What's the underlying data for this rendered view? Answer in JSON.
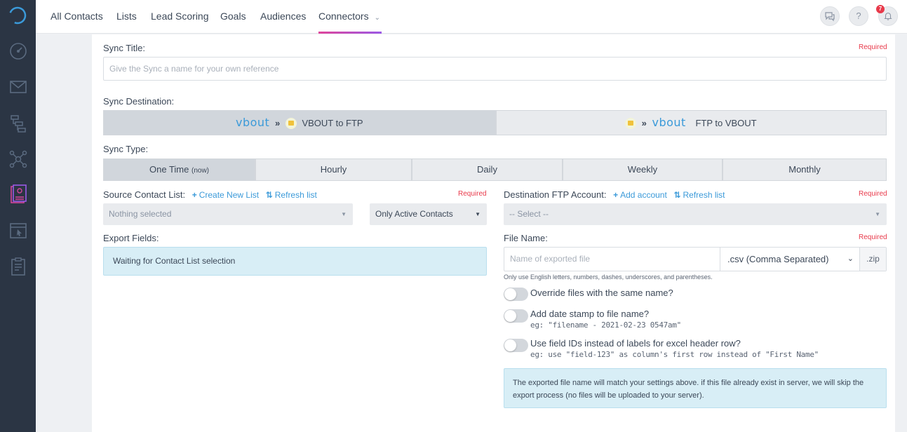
{
  "nav": {
    "items": [
      "All Contacts",
      "Lists",
      "Lead Scoring",
      "Goals",
      "Audiences",
      "Connectors"
    ],
    "notification_count": "7",
    "help_label": "?"
  },
  "form": {
    "sync_title": {
      "label": "Sync Title:",
      "required": "Required",
      "placeholder": "Give the Sync a name for your own reference"
    },
    "destination": {
      "label": "Sync Destination:",
      "vbout_to_ftp": {
        "brand": "vbout",
        "arrows": "»",
        "label": "VBOUT to FTP"
      },
      "ftp_to_vbout": {
        "brand": "vbout",
        "arrows": "»",
        "label": "FTP to VBOUT"
      }
    },
    "sync_type": {
      "label": "Sync Type:",
      "options": [
        {
          "label": "One Time",
          "suffix": "(now)"
        },
        {
          "label": "Hourly",
          "suffix": ""
        },
        {
          "label": "Daily",
          "suffix": ""
        },
        {
          "label": "Weekly",
          "suffix": ""
        },
        {
          "label": "Monthly",
          "suffix": ""
        }
      ]
    },
    "source": {
      "label": "Source Contact List:",
      "create_link": "Create New List",
      "refresh_link": "Refresh list",
      "required": "Required",
      "list_select": "Nothing selected",
      "status_select": "Only Active Contacts"
    },
    "destination_ftp": {
      "label": "Destination FTP Account:",
      "add_link": "Add account",
      "refresh_link": "Refresh list",
      "required": "Required",
      "select": "-- Select --"
    },
    "export_fields": {
      "label": "Export Fields:",
      "waiting": "Waiting for Contact List selection"
    },
    "file_name": {
      "label": "File Name:",
      "required": "Required",
      "placeholder": "Name of exported file",
      "format": ".csv (Comma Separated)",
      "ext": ".zip",
      "hint": "Only use English letters, numbers, dashes, underscores, and parentheses."
    },
    "toggles": [
      {
        "label": "Override files with the same name?",
        "sub": "",
        "on": false
      },
      {
        "label": "Add date stamp to file name?",
        "sub": "eg: \"filename - 2021-02-23 0547am\"",
        "on": false
      },
      {
        "label": "Use field IDs instead of labels for excel header row?",
        "sub": "eg: use \"field-123\" as column's first row instead of \"First Name\"",
        "on": false
      }
    ],
    "notice": "The exported file name will match your settings above. if this file already exist in server, we will skip the export process (no files will be uploaded to your server)."
  }
}
